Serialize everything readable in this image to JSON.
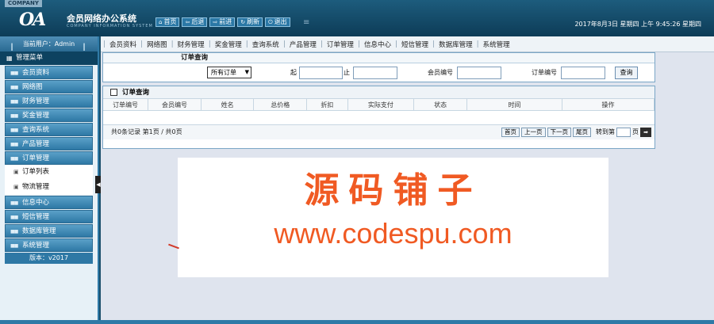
{
  "header": {
    "company_tag": "COMPANY",
    "logo_text": "OA",
    "title": "会员网络办公系统",
    "subtitle": "COMPANY INFORMATION SYSTEM",
    "nav": [
      {
        "label": "首页",
        "icon": "home-icon",
        "glyph": "⌂"
      },
      {
        "label": "后退",
        "icon": "back-icon",
        "glyph": "⇦"
      },
      {
        "label": "前进",
        "icon": "forward-icon",
        "glyph": "⇨"
      },
      {
        "label": "刷新",
        "icon": "refresh-icon",
        "glyph": "↻"
      },
      {
        "label": "退出",
        "icon": "power-icon",
        "glyph": "⏻"
      }
    ],
    "datetime": "2017年8月3日 星期四 上午 9:45:26 星期四"
  },
  "sidebar": {
    "current_user": "当前用户：Admin",
    "menu_title": "管理菜单",
    "groups_top": [
      "会员资料",
      "网络图",
      "财务管理",
      "奖金管理",
      "查询系统",
      "产品管理",
      "订单管理"
    ],
    "sub_items": [
      "订单列表",
      "物流管理"
    ],
    "groups_bottom": [
      "信息中心",
      "短信管理",
      "数据库管理",
      "系统管理"
    ],
    "version": "版本：v2017"
  },
  "tabs": [
    "会员资料",
    "网络图",
    "财务管理",
    "奖金管理",
    "查询系统",
    "产品管理",
    "订单管理",
    "信息中心",
    "短信管理",
    "数据库管理",
    "系统管理"
  ],
  "search": {
    "title": "订单查询",
    "status_select": "所有订单",
    "from_label": "起",
    "to_label": "止",
    "member_label": "会员编号",
    "order_label": "订单编号",
    "button": "查询"
  },
  "list": {
    "title": "订单查询",
    "columns": [
      "订单编号",
      "会员编号",
      "姓名",
      "总价格",
      "折扣",
      "实际支付",
      "状态",
      "时间",
      "操作"
    ],
    "record_info": "共0条记录  第1页 / 共0页",
    "pager": {
      "first": "首页",
      "prev": "上一页",
      "next": "下一页",
      "last": "尾页",
      "goto_prefix": "转到第",
      "goto_suffix": "页"
    }
  },
  "watermark": {
    "cn": "源码铺子",
    "url": "www.codespu.com"
  },
  "colors": {
    "header_bg": "#1d5c7d",
    "accent": "#2f7aa7",
    "watermark": "#f05a23"
  }
}
